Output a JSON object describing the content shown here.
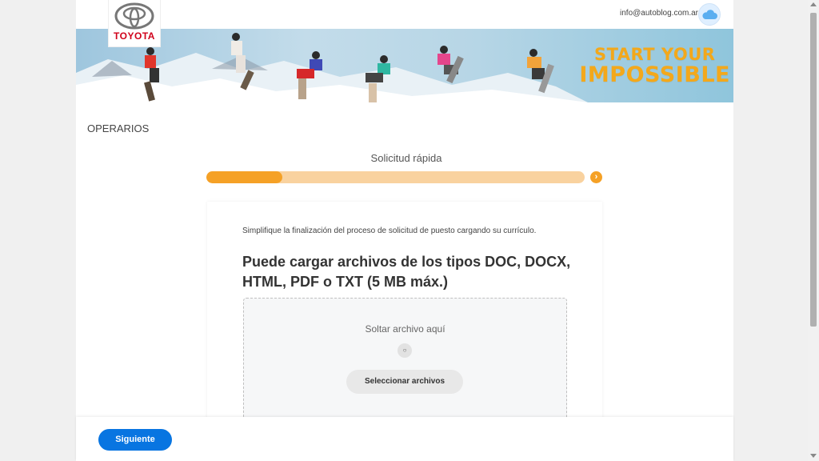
{
  "brand": {
    "logo_text": "TOYOTA",
    "brand_color": "#d0021b"
  },
  "account": {
    "email": "info@autoblog.com.ar",
    "icon": "cloud-icon"
  },
  "banner": {
    "headline_line1": "START YOUR",
    "headline_line2": "IMPOSSIBLE",
    "headline_color": "#f3a81b"
  },
  "page": {
    "section_title": "OPERARIOS"
  },
  "progress": {
    "step_title": "Solicitud rápida",
    "percent": 20,
    "accent": "#f5a126",
    "track": "#f9d29f",
    "next_icon": "chevron-right-icon"
  },
  "upload": {
    "intro": "Simplifique la finalización del proceso de solicitud de puesto cargando su currículo.",
    "heading": "Puede cargar archivos de los tipos DOC, DOCX, HTML, PDF o TXT (5 MB máx.)",
    "drop_text": "Soltar archivo aquí",
    "drop_icon": "upload-icon",
    "select_button": "Seleccionar archivos"
  },
  "footer": {
    "next_button": "Siguiente",
    "button_color": "#0875e1"
  }
}
